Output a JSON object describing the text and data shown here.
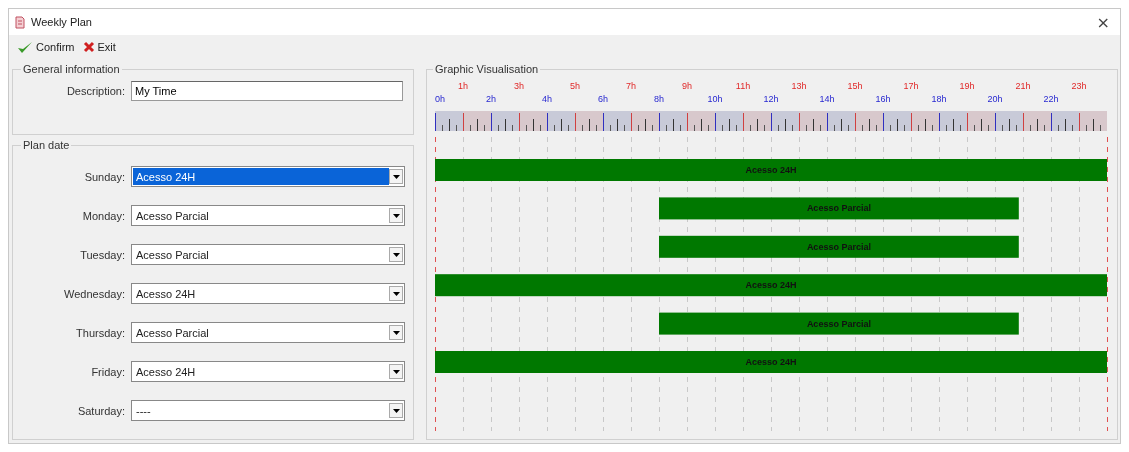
{
  "window": {
    "title": "Weekly Plan",
    "close": "×"
  },
  "toolbar": [
    {
      "label": "Confirm",
      "kind": "confirm"
    },
    {
      "label": "Exit",
      "kind": "exit"
    }
  ],
  "general_information": {
    "title": "General information",
    "description": {
      "label": "Description:",
      "value": "My Time"
    }
  },
  "plan_date": {
    "title": "Plan date",
    "days": [
      {
        "label": "Sunday:",
        "value": "Acesso 24H",
        "selected": true
      },
      {
        "label": "Monday:",
        "value": "Acesso Parcial",
        "selected": false
      },
      {
        "label": "Tuesday:",
        "value": "Acesso Parcial",
        "selected": false
      },
      {
        "label": "Wednesday:",
        "value": "Acesso 24H",
        "selected": false
      },
      {
        "label": "Thursday:",
        "value": "Acesso Parcial",
        "selected": false
      },
      {
        "label": "Friday:",
        "value": "Acesso 24H",
        "selected": false
      },
      {
        "label": "Saturday:",
        "value": "----",
        "selected": false
      }
    ]
  },
  "graphic_visualisation": {
    "title": "Graphic Visualisation",
    "odd_hours": [
      "1h",
      "3h",
      "5h",
      "7h",
      "9h",
      "11h",
      "13h",
      "15h",
      "17h",
      "19h",
      "21h",
      "23h"
    ],
    "even_hours": [
      "0h",
      "2h",
      "4h",
      "6h",
      "8h",
      "10h",
      "12h",
      "14h",
      "16h",
      "18h",
      "20h",
      "22h"
    ],
    "bars": [
      {
        "label": "Acesso 24H",
        "kind": "full"
      },
      {
        "label": "Acesso Parcial",
        "kind": "partial"
      },
      {
        "label": "Acesso Parcial",
        "kind": "partial"
      },
      {
        "label": "Acesso 24H",
        "kind": "full"
      },
      {
        "label": "Acesso Parcial",
        "kind": "partial"
      },
      {
        "label": "Acesso 24H",
        "kind": "full"
      }
    ]
  }
}
